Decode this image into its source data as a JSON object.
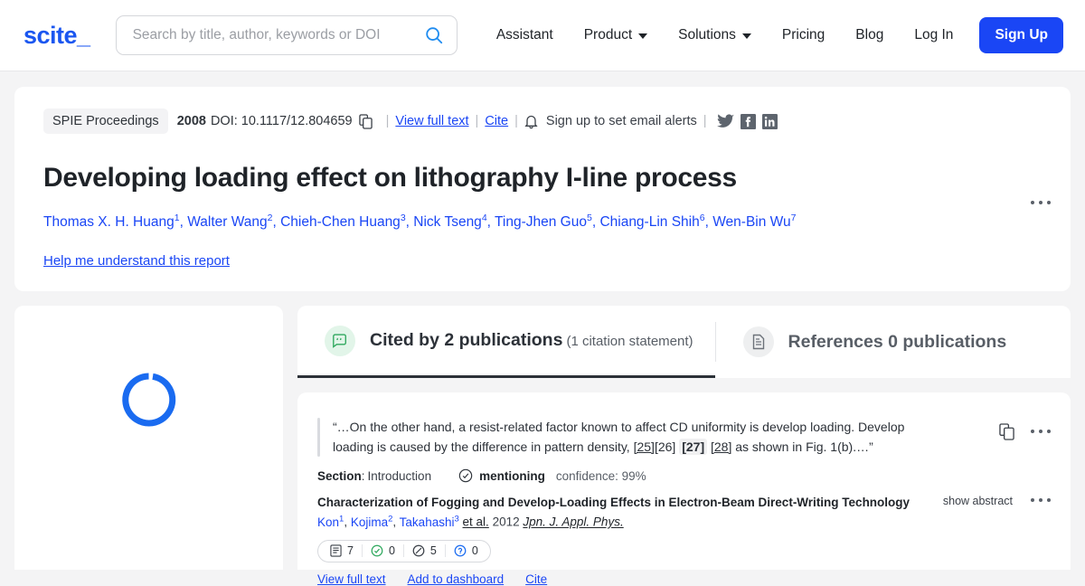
{
  "header": {
    "logo": "scite_",
    "search": {
      "placeholder": "Search by title, author, keywords or DOI",
      "value": "",
      "icon": "search-icon"
    },
    "nav": [
      {
        "label": "Assistant",
        "caret": false
      },
      {
        "label": "Product",
        "caret": true
      },
      {
        "label": "Solutions",
        "caret": true
      },
      {
        "label": "Pricing",
        "caret": false
      },
      {
        "label": "Blog",
        "caret": false
      },
      {
        "label": "Log In",
        "caret": false
      }
    ],
    "signup_label": "Sign Up",
    "signup_color": "#1a46f5"
  },
  "paper": {
    "journal": "SPIE Proceedings",
    "year": "2008",
    "doi_label": "DOI: 10.1117/12.804659",
    "copy_icon": "copy-icon",
    "view_full_text": "View full text",
    "cite": "Cite",
    "bell_icon": "bell-icon",
    "alerts": "Sign up to set email alerts",
    "separator": "|",
    "social": [
      "twitter-icon",
      "facebook-icon",
      "linkedin-icon"
    ],
    "title": "Developing loading effect on lithography I-line process",
    "authors": [
      {
        "name": "Thomas X. H. Huang",
        "sup": "1"
      },
      {
        "name": "Walter Wang",
        "sup": "2"
      },
      {
        "name": "Chieh-Chen Huang",
        "sup": "3"
      },
      {
        "name": "Nick Tseng",
        "sup": "4"
      },
      {
        "name": "Ting-Jhen Guo",
        "sup": "5"
      },
      {
        "name": "Chiang-Lin Shih",
        "sup": "6"
      },
      {
        "name": "Wen-Bin Wu",
        "sup": "7"
      }
    ],
    "help_link": "Help me understand this report"
  },
  "left_panel": {
    "state": "loading",
    "spinner_color": "#1a6bf0"
  },
  "tabs": [
    {
      "icon": "quote-bubble-icon",
      "label": "Cited by 2 publications",
      "sublabel": "(1 citation statement)",
      "active": true
    },
    {
      "icon": "document-icon",
      "label": "References 0 publications",
      "sublabel": "",
      "active": false
    }
  ],
  "citation": {
    "quote_open": "“…On the other hand, a resist-related factor known to affect CD uniformity is develop loading. Develop loading is caused by the difference in pattern density, ",
    "ref_1": "[25]",
    "ref_2": "[26]",
    "ref_3": "[27]",
    "ref_4": "[28]",
    "quote_close": " as shown in Fig. 1(b).…”",
    "section_label": "Section",
    "section_value": "Introduction",
    "classification_icon": "check-circle-icon",
    "classification": "mentioning",
    "confidence": "confidence: 99%",
    "cited_title": "Characterization of Fogging and Develop-Loading Effects in Electron-Beam Direct-Writing Technology",
    "cited_authors": [
      {
        "name": "Kon",
        "sup": "1"
      },
      {
        "name": "Kojima",
        "sup": "2"
      },
      {
        "name": "Takahashi",
        "sup": "3"
      }
    ],
    "et_al": "et al.",
    "cited_year": "2012",
    "cited_journal": "Jpn. J. Appl. Phys.",
    "badges": [
      {
        "icon": "citation-count-icon",
        "value": "7",
        "color": "#3b4048"
      },
      {
        "icon": "supporting-icon",
        "value": "0",
        "color": "#2fa85e"
      },
      {
        "icon": "mentioning-icon",
        "value": "5",
        "color": "#3b4048"
      },
      {
        "icon": "contrasting-icon",
        "value": "0",
        "color": "#1a6bf0"
      }
    ],
    "bottom_links": [
      "View full text",
      "Add to dashboard",
      "Cite"
    ],
    "copy_icon": "copy-icon",
    "kebab_icon": "more-options-icon",
    "show_abstract": "show abstract"
  }
}
